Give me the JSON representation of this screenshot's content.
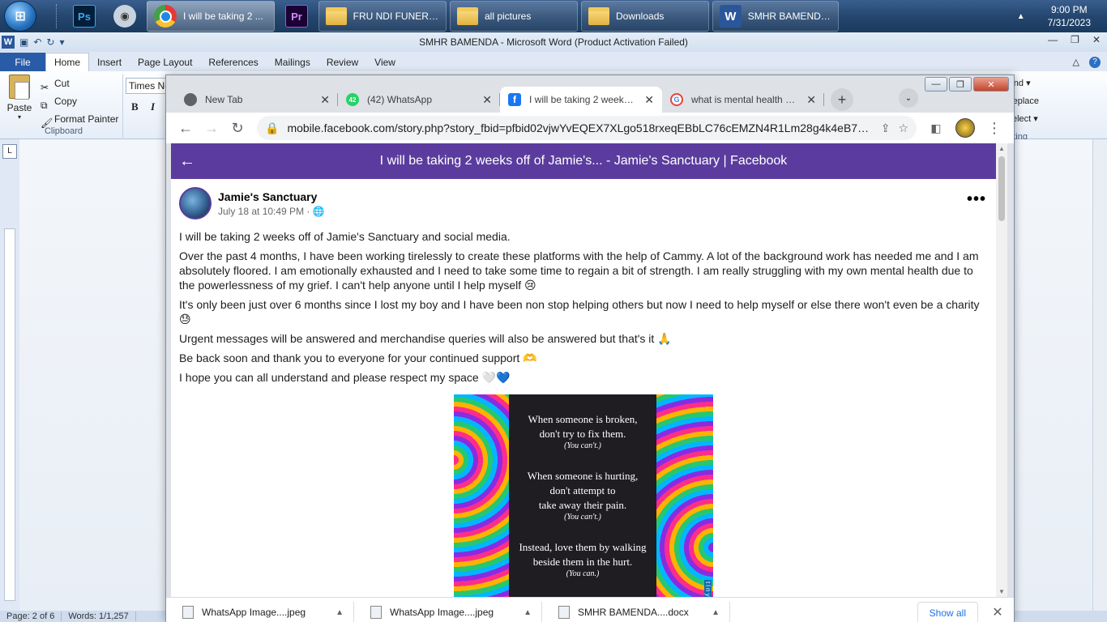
{
  "taskbar": {
    "tasks": [
      {
        "label": "I will be taking 2 ..."
      },
      {
        "label": "FRU NDI FUNERAL"
      },
      {
        "label": "all pictures"
      },
      {
        "label": "Downloads"
      },
      {
        "label": "SMHR BAMENDA..."
      }
    ],
    "pinned": {
      "photoshop": "Ps",
      "premiere": "Pr"
    },
    "clock": {
      "time": "9:00 PM",
      "date": "7/31/2023"
    }
  },
  "word": {
    "title": "SMHR BAMENDA  -  Microsoft Word (Product Activation Failed)",
    "file_tab": "File",
    "tabs": [
      "Home",
      "Insert",
      "Page Layout",
      "References",
      "Mailings",
      "Review",
      "View"
    ],
    "clipboard": {
      "paste": "Paste",
      "cut": "Cut",
      "copy": "Copy",
      "format_painter": "Format Painter",
      "group": "Clipboard"
    },
    "font_name": "Times Ne",
    "bold": "B",
    "italic": "I",
    "editing": {
      "find": "Find",
      "replace": "Replace",
      "select": "Select",
      "group": "diting"
    },
    "status": {
      "page": "Page: 2 of 6",
      "words": "Words: 1/1,257"
    }
  },
  "chrome": {
    "tabs": [
      {
        "label": "New Tab",
        "favicon": "chrome-icon"
      },
      {
        "label": "(42) WhatsApp",
        "favicon": "whatsapp-icon",
        "badge": "42"
      },
      {
        "label": "I will be taking 2 weeks of",
        "favicon": "facebook-icon",
        "active": true
      },
      {
        "label": "what is mental health and",
        "favicon": "google-icon"
      }
    ],
    "url": "mobile.facebook.com/story.php?story_fbid=pfbid02vjwYvEQEX7XLgo518rxeqEBbLC76cEMZN4R1Lm28g4k4eB71t..."
  },
  "page": {
    "header_title": "I will be taking 2 weeks off of Jamie's... - Jamie's Sanctuary | Facebook",
    "post": {
      "author": "Jamie's Sanctuary",
      "time": "July 18 at 10:49 PM · ",
      "paragraphs": [
        "I will be taking 2 weeks off of Jamie's Sanctuary and social media.",
        "Over the past 4 months, I have been working tirelessly to create these platforms with the help of Cammy. A lot of the background work has needed me and I am absolutely floored. I am emotionally exhausted and I need to take some time to regain a bit of strength. I am really struggling with my own mental health due to the powerlessness of my grief. I can't help anyone until I help myself 😢",
        "It's only been just over 6 months since I lost my boy and I have been non stop helping others but now I need to help myself or else there won't even be a charity 😓",
        "Urgent messages will be answered and merchandise queries will also be answered but that's it 🙏",
        "Be back soon and thank you to everyone for your continued support 🫶",
        "I hope you can all understand and please respect my space 🤍💙"
      ],
      "image_text": {
        "line1a": "When someone is broken,",
        "line1b": "don't try to fix them.",
        "line1c": "(You can't.)",
        "line2a": "When someone is hurting,",
        "line2b": "don't attempt to",
        "line2c": "take away their pain.",
        "line2d": "(You can't.)",
        "line3a": "Instead, love them by walking",
        "line3b": "beside them in the hurt.",
        "line3c": "(You can.)",
        "watermark": "tlnyb"
      }
    }
  },
  "downloads": {
    "items": [
      "WhatsApp Image....jpeg",
      "WhatsApp Image....jpeg",
      "SMHR BAMENDA....docx"
    ],
    "show_all": "Show all"
  }
}
